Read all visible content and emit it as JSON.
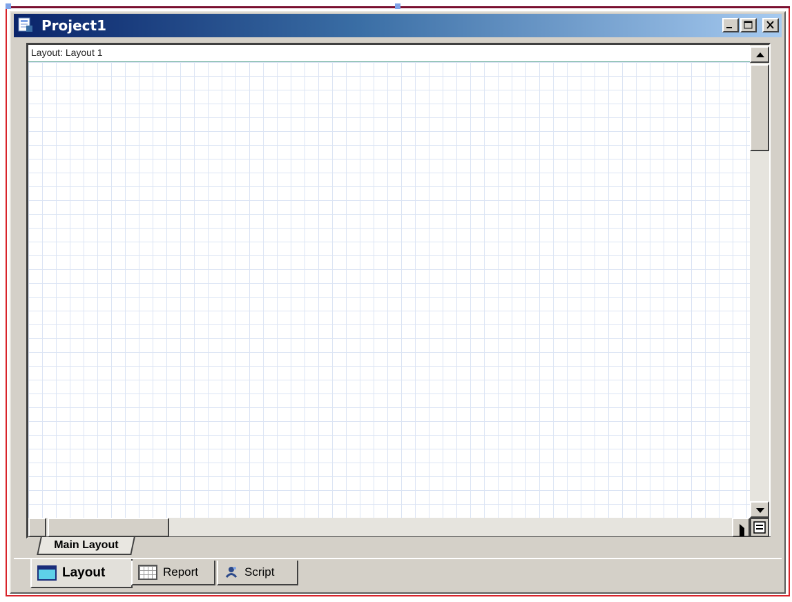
{
  "window": {
    "title": "Project1",
    "icons": {
      "app": "project-app-icon",
      "minimize": "minimize-icon",
      "maximize": "maximize-icon",
      "close": "close-icon"
    }
  },
  "canvas": {
    "header_label": "Layout: Layout 1"
  },
  "sheet_tabs": [
    {
      "label": "Main Layout",
      "active": true
    }
  ],
  "bottom_tabs": [
    {
      "label": "Layout",
      "icon": "layout-icon",
      "active": true
    },
    {
      "label": "Report",
      "icon": "report-icon",
      "active": false
    },
    {
      "label": "Script",
      "icon": "script-icon",
      "active": false
    }
  ],
  "colors": {
    "titlebar_start": "#0a246a",
    "titlebar_end": "#a6caf0",
    "selection_frame": "#d8232a",
    "grid_line": "#dbe4f4"
  }
}
